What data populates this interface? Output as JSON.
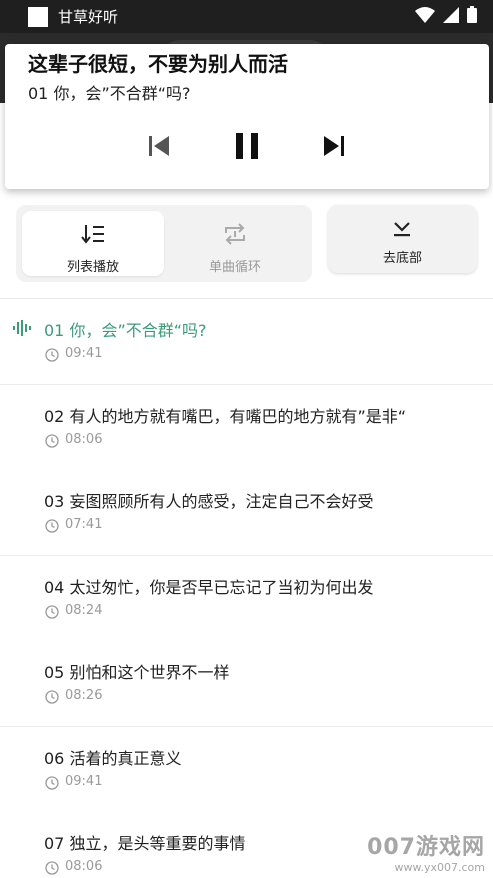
{
  "status_bar": {
    "app_name": "甘草好听"
  },
  "player": {
    "title": "这辈子很短，不要为别人而活",
    "subtitle": "01 你，会”不合群“吗?"
  },
  "modes": {
    "list_play": "列表播放",
    "single_loop": "单曲循环",
    "to_bottom": "去底部"
  },
  "tracks": [
    {
      "title": "01 你，会”不合群“吗?",
      "duration": "09:41",
      "playing": true
    },
    {
      "title": "02 有人的地方就有嘴巴，有嘴巴的地方就有”是非“",
      "duration": "08:06"
    },
    {
      "title": "03 妄图照顾所有人的感受，注定自己不会好受",
      "duration": "07:41"
    },
    {
      "title": "04 太过匆忙，你是否早已忘记了当初为何出发",
      "duration": "08:24"
    },
    {
      "title": "05 别怕和这个世界不一样",
      "duration": "08:26"
    },
    {
      "title": "06 活着的真正意义",
      "duration": "09:41"
    },
    {
      "title": "07 独立，是头等重要的事情",
      "duration": "08:06"
    }
  ],
  "watermark": {
    "main": "007游戏网",
    "url": "www.yx007.com"
  },
  "colors": {
    "accent": "#3c9b79",
    "status_bar": "#1f1f1f"
  }
}
